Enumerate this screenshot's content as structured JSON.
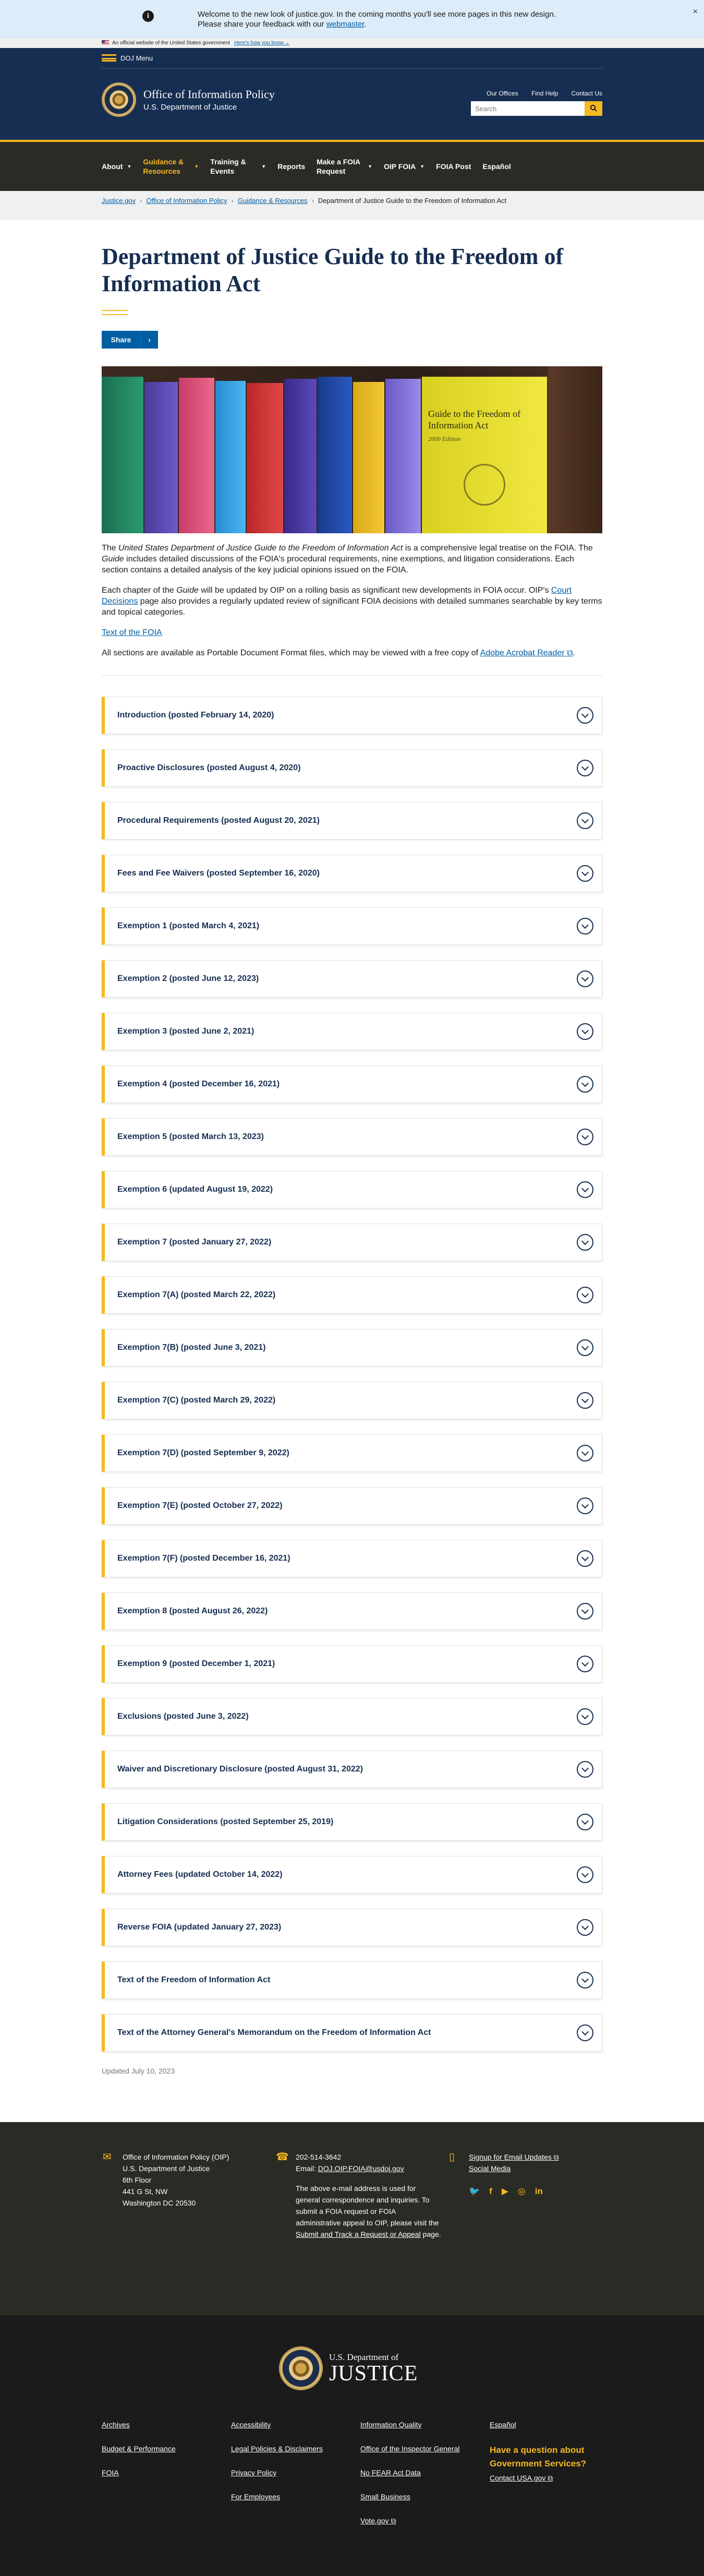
{
  "banner": {
    "text": "Welcome to the new look of justice.gov. In the coming months you'll see more pages in this new design. Please share your feedback with our ",
    "link": "webmaster",
    "close": "×",
    "gov_text": "An official website of the United States government",
    "gov_link": "Here's how you know ⌄"
  },
  "header": {
    "menu": "DOJ Menu",
    "site_title": "Office of Information Policy",
    "site_sub": "U.S. Department of Justice",
    "links": [
      "Our Offices",
      "Find Help",
      "Contact Us"
    ],
    "search_placeholder": "Search"
  },
  "nav": [
    {
      "label": "About",
      "dd": true,
      "active": false
    },
    {
      "label": "Guidance & Resources",
      "dd": true,
      "active": true
    },
    {
      "label": "Training & Events",
      "dd": true,
      "active": false
    },
    {
      "label": "Reports",
      "dd": false,
      "active": false
    },
    {
      "label": "Make a FOIA Request",
      "dd": true,
      "active": false
    },
    {
      "label": "OIP FOIA",
      "dd": true,
      "active": false
    },
    {
      "label": "FOIA Post",
      "dd": false,
      "active": false
    },
    {
      "label": "Español",
      "dd": false,
      "active": false
    }
  ],
  "breadcrumb": [
    "Justice.gov",
    "Office of Information Policy",
    "Guidance & Resources",
    "Department of Justice Guide to the Freedom of Information Act"
  ],
  "page": {
    "title": "Department of Justice Guide to the Freedom of Information Act",
    "share": "Share",
    "p1_a": "The ",
    "p1_em": "United States Department of Justice Guide to the Freedom of Information Act",
    "p1_b": " is a comprehensive legal treatise on the FOIA. The ",
    "p1_em2": "Guide",
    "p1_c": " includes detailed discussions of the FOIA's procedural requirements, nine exemptions, and litigation considerations. Each section contains a detailed analysis of the key judicial opinions issued on the FOIA.",
    "p2_a": "Each chapter of the ",
    "p2_em": "Guide",
    "p2_b": " will be updated by OIP on a rolling basis as significant new developments in FOIA occur.  OIP's ",
    "p2_link": "Court Decisions",
    "p2_c": " page also provides a regularly updated review of significant FOIA decisions with detailed summaries searchable by key terms and topical categories.",
    "text_link": "Text of the FOIA",
    "p3_a": "All sections are available as Portable Document Format files, which may be viewed with a free copy of ",
    "p3_link": "Adobe Acrobat Reader",
    "book_title": "Guide to the Freedom of Information Act",
    "book_ed": "2009 Edition",
    "updated": "Updated July 10, 2023"
  },
  "accordion": [
    "Introduction (posted February 14, 2020)",
    "Proactive Disclosures (posted August 4, 2020)",
    "Procedural Requirements (posted August 20, 2021)",
    "Fees and Fee Waivers (posted September 16, 2020)",
    "Exemption 1 (posted March 4, 2021)",
    "Exemption 2 (posted June 12, 2023)",
    "Exemption 3 (posted June 2, 2021)",
    "Exemption 4 (posted December 16, 2021)",
    "Exemption 5 (posted March 13, 2023)",
    "Exemption 6 (updated August 19, 2022)",
    "Exemption 7 (posted January 27, 2022)",
    "Exemption 7(A) (posted March 22, 2022)",
    "Exemption 7(B) (posted June 3, 2021)",
    "Exemption 7(C) (posted March 29, 2022)",
    "Exemption 7(D) (posted September 9, 2022)",
    "Exemption 7(E) (posted October 27, 2022)",
    "Exemption 7(F) (posted December 16, 2021)",
    "Exemption 8 (posted August 26, 2022)",
    "Exemption 9 (posted December 1, 2021)",
    "Exclusions (posted June 3, 2022)",
    "Waiver and Discretionary Disclosure (posted August 31, 2022)",
    "Litigation Considerations (posted September 25, 2019)",
    "Attorney Fees (updated October 14, 2022)",
    "Reverse FOIA (updated January 27, 2023)",
    "Text of the Freedom of Information Act",
    "Text of the Attorney General's Memorandum on the Freedom of Information Act"
  ],
  "footer": {
    "address": [
      "Office of Information Policy (OIP)",
      "U.S. Department of Justice",
      "6th Floor",
      "441 G St, NW",
      "Washington DC 20530"
    ],
    "phone": "202-514-3642",
    "email_label": "Email: ",
    "email": "DOJ.OIP.FOIA@usdoj.gov",
    "note": "The above e-mail address is used for general correspondence and inquiries. To submit a FOIA request or FOIA administrative appeal to OIP, please visit the ",
    "note_link": "Submit and Track a Request or Appeal",
    "note_end": " page.",
    "signup": "Signup for Email Updates",
    "social": "Social Media",
    "dept_small": "U.S. Department of",
    "dept_large": "JUSTICE",
    "links": [
      [
        "Archives",
        "Budget & Performance",
        "FOIA"
      ],
      [
        "Accessibility",
        "Legal Policies & Disclaimers",
        "Privacy Policy",
        "For Employees"
      ],
      [
        "Information Quality",
        "Office of the Inspector General",
        "No FEAR Act Data",
        "Small Business",
        "Vote.gov"
      ],
      [
        "Español"
      ]
    ],
    "question": "Have a question about Government Services?",
    "contact": "Contact USA.gov"
  }
}
